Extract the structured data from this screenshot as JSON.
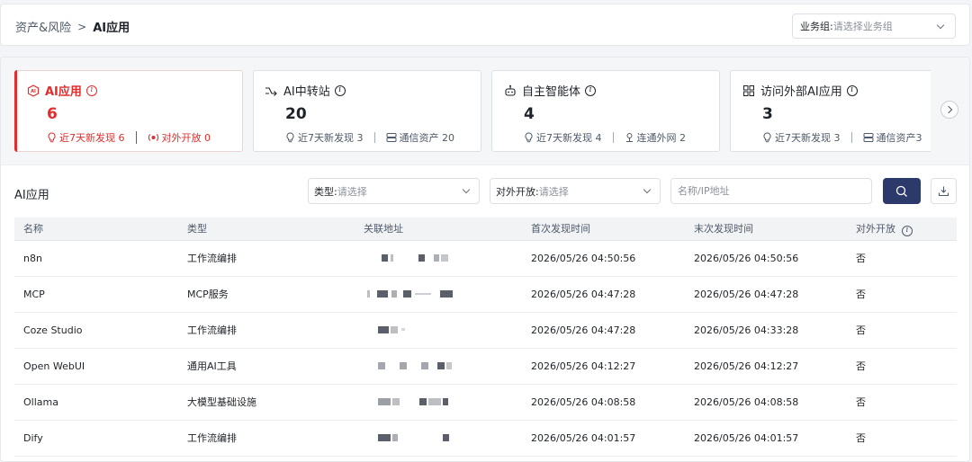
{
  "breadcrumb": {
    "parent": "资产&风险",
    "separator": ">",
    "current": "AI应用"
  },
  "business_group": {
    "label": "业务组:",
    "placeholder": "请选择业务组"
  },
  "cards": [
    {
      "title": "AI应用",
      "count": "6",
      "icon": "ai-shield-icon",
      "active": true,
      "stat1": "近7天新发现 6",
      "stat1_icon": "lightbulb-icon",
      "stat2": "对外开放 0",
      "stat2_icon": "broadcast-icon"
    },
    {
      "title": "AI中转站",
      "count": "20",
      "icon": "relay-arrow-icon",
      "active": false,
      "stat1": "近7天新发现 3",
      "stat1_icon": "lightbulb-icon",
      "stat2": "通信资产 20",
      "stat2_icon": "server-icon"
    },
    {
      "title": "自主智能体",
      "count": "4",
      "icon": "agent-icon",
      "active": false,
      "stat1": "近7天新发现 4",
      "stat1_icon": "lightbulb-icon",
      "stat2": "连通外网 2",
      "stat2_icon": "pin-icon"
    },
    {
      "title": "访问外部AI应用",
      "count": "3",
      "icon": "apps-grid-icon",
      "active": false,
      "stat1": "近7天新发现 3",
      "stat1_icon": "lightbulb-icon",
      "stat2": "通信资产3",
      "stat2_icon": "server-icon"
    }
  ],
  "list": {
    "title": "AI应用",
    "filters": {
      "type": {
        "label": "类型:",
        "placeholder": "请选择"
      },
      "exposure": {
        "label": "对外开放:",
        "placeholder": "请选择"
      },
      "search_placeholder": "名称/IP地址"
    },
    "columns": [
      "名称",
      "类型",
      "关联地址",
      "首次发现时间",
      "末次发现时间",
      "对外开放"
    ],
    "rows": [
      {
        "name": "n8n",
        "type": "工作流编排",
        "first": "2026/05/26 04:50:56",
        "last": "2026/05/26 04:50:56",
        "exposed": "否"
      },
      {
        "name": "MCP",
        "type": "MCP服务",
        "first": "2026/05/26 04:47:28",
        "last": "2026/05/26 04:47:28",
        "exposed": "否"
      },
      {
        "name": "Coze Studio",
        "type": "工作流编排",
        "first": "2026/05/26 04:47:28",
        "last": "2026/05/26 04:33:28",
        "exposed": "否"
      },
      {
        "name": "Open WebUI",
        "type": "通用AI工具",
        "first": "2026/05/26 04:12:27",
        "last": "2026/05/26 04:12:27",
        "exposed": "否"
      },
      {
        "name": "Ollama",
        "type": "大模型基础设施",
        "first": "2026/05/26 04:08:58",
        "last": "2026/05/26 04:08:58",
        "exposed": "否"
      },
      {
        "name": "Dify",
        "type": "工作流编排",
        "first": "2026/05/26 04:01:57",
        "last": "2026/05/26 04:01:57",
        "exposed": "否"
      }
    ]
  },
  "colors": {
    "accent_red": "#e02d2d",
    "primary_navy": "#2c3a6b"
  }
}
